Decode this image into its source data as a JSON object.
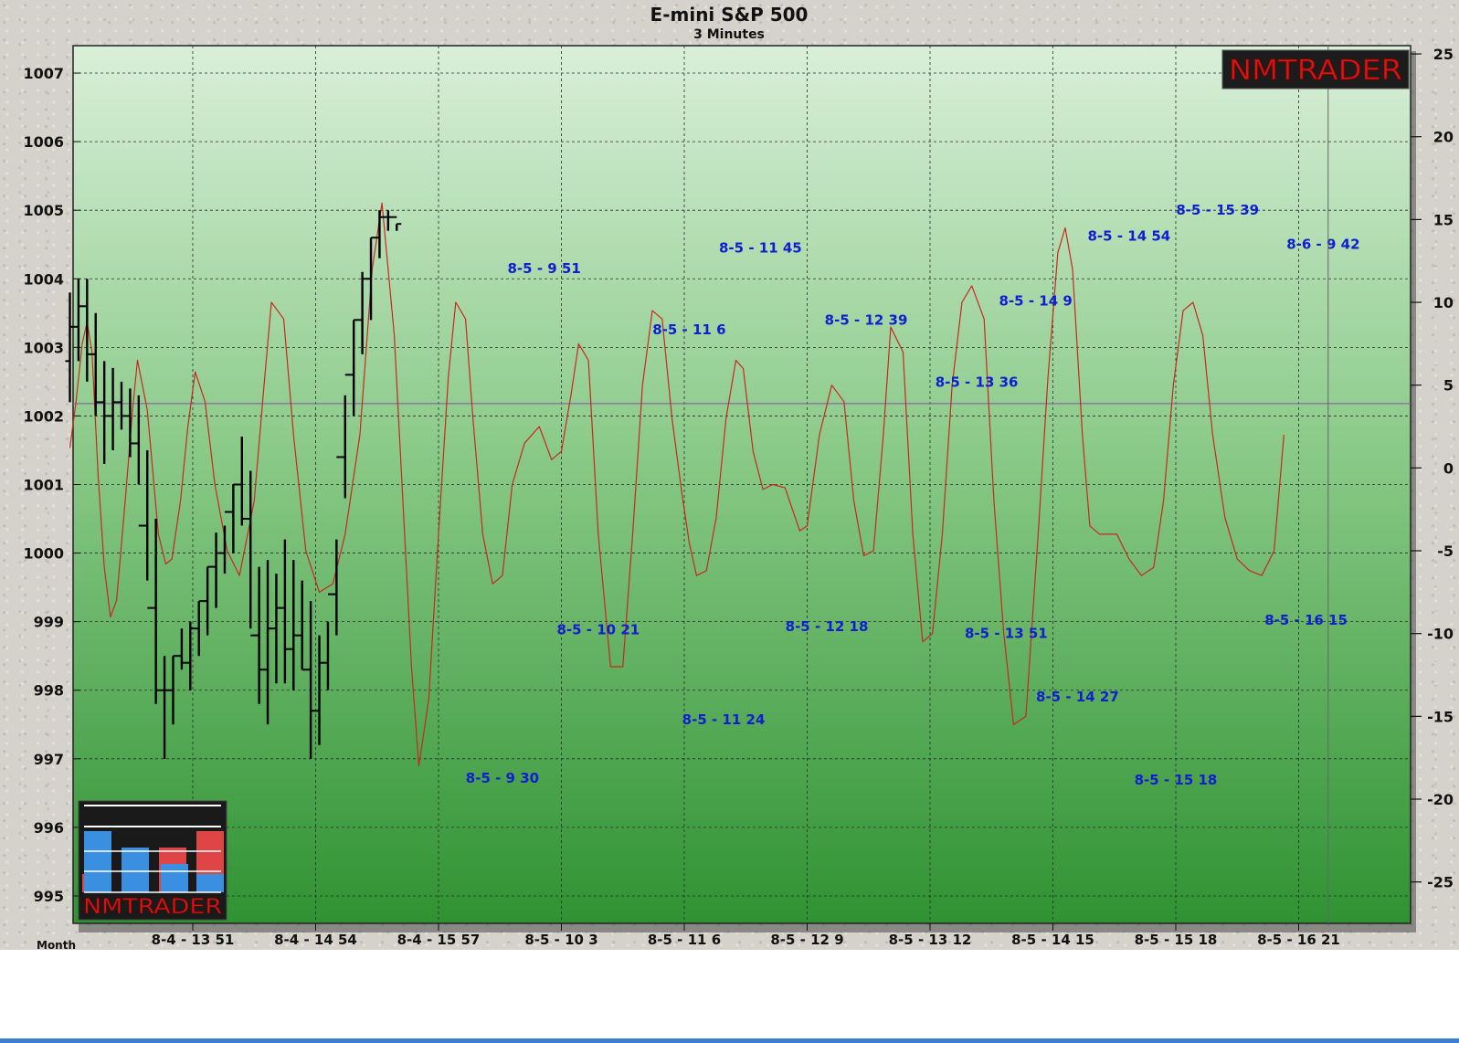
{
  "chart_data": {
    "type": "line",
    "title": "E-mini S&P 500",
    "subtitle": "3 Minutes",
    "xlabel": "Month",
    "x_ticks": [
      "8-4 - 13 51",
      "8-4 - 14 54",
      "8-4 - 15 57",
      "8-5 - 10 3",
      "8-5 - 11 6",
      "8-5 - 12 9",
      "8-5 - 13 12",
      "8-5 - 14 15",
      "8-5 - 15 18",
      "8-5 - 16 21"
    ],
    "left_axis": {
      "ticks": [
        995,
        996,
        997,
        998,
        999,
        1000,
        1001,
        1002,
        1003,
        1004,
        1005,
        1006,
        1007
      ],
      "range": [
        994.6,
        1007.4
      ]
    },
    "right_axis": {
      "ticks": [
        25,
        20,
        15,
        10,
        5,
        0,
        -5,
        -10,
        -15,
        -20,
        -25
      ],
      "range": [
        -27.5,
        25.5
      ]
    },
    "reference_line_price": 1002.18,
    "cursor_line_label_index": 9.24,
    "grid": true,
    "logo_text": "NMTRADER",
    "colors": {
      "price": "#000000",
      "oscillator": "#c8281e",
      "annotations": "#1020d0",
      "grid": "#2a2a2a",
      "reference_line": "#8a6aa0"
    },
    "series": [
      {
        "role": "price-bars",
        "x_index": [
          0.0,
          0.07,
          0.14,
          0.21,
          0.28,
          0.35,
          0.42,
          0.49,
          0.56,
          0.63,
          0.7,
          0.77,
          0.84,
          0.91,
          0.98,
          1.05,
          1.12,
          1.19,
          1.26,
          1.33,
          1.4,
          1.47,
          1.54,
          1.61,
          1.68,
          1.75,
          1.82,
          1.89,
          1.96,
          2.03,
          2.1,
          2.17,
          2.24,
          2.31,
          2.38,
          2.45,
          2.52,
          2.59,
          2.66,
          2.73,
          2.8,
          2.87,
          2.94,
          3.01,
          3.08,
          3.15,
          3.22,
          3.29,
          3.36,
          3.45,
          3.55,
          3.6,
          3.65
        ],
        "high": [
          1003.8,
          1004.0,
          1004.0,
          1003.5,
          1002.8,
          1002.7,
          1002.5,
          1002.4,
          1002.3,
          1001.5,
          1000.5,
          998.5,
          998.5,
          998.9,
          999.0,
          999.3,
          999.8,
          1000.3,
          1000.4,
          1001.0,
          1001.7,
          1001.2,
          999.8,
          999.9,
          999.7,
          1000.2,
          999.9,
          999.6,
          999.3,
          998.8,
          999.0,
          1000.2,
          1002.3,
          1003.4,
          1004.1,
          1004.6,
          1005.0,
          1005.0,
          1004.8
        ],
        "low": [
          1002.2,
          1002.8,
          1002.5,
          1002.0,
          1001.3,
          1001.5,
          1001.8,
          1001.4,
          1001.0,
          999.6,
          997.8,
          997.0,
          997.5,
          998.3,
          998.0,
          998.5,
          998.8,
          999.2,
          999.7,
          1000.0,
          1000.4,
          998.9,
          997.8,
          997.5,
          998.1,
          998.1,
          998.0,
          998.3,
          997.0,
          997.2,
          998.0,
          998.8,
          1000.8,
          1002.0,
          1002.9,
          1003.4,
          1004.3,
          1004.7,
          1004.7
        ],
        "open": [
          1002.8,
          1003.3,
          1003.6,
          1002.9,
          1002.2,
          1002.0,
          1002.2,
          1002.0,
          1001.6,
          1000.4,
          999.2,
          998.0,
          998.0,
          998.5,
          998.4,
          998.9,
          999.3,
          999.8,
          1000.0,
          1000.6,
          1001.0,
          1000.5,
          998.8,
          998.3,
          998.9,
          999.2,
          998.6,
          998.8,
          998.3,
          997.7,
          998.4,
          999.4,
          1001.4,
          1002.6,
          1003.4,
          1004.0,
          1004.6,
          1004.9,
          1004.9
        ],
        "close": [
          1003.3,
          1003.6,
          1002.9,
          1002.2,
          1002.0,
          1002.2,
          1002.0,
          1001.6,
          1000.4,
          999.2,
          998.0,
          998.0,
          998.5,
          998.4,
          998.9,
          999.3,
          999.8,
          1000.0,
          1000.6,
          1001.0,
          1000.5,
          998.8,
          998.3,
          998.9,
          999.2,
          998.6,
          998.8,
          998.3,
          997.7,
          998.4,
          999.4,
          1001.4,
          1002.6,
          1003.4,
          1004.0,
          1004.6,
          1004.9,
          1004.9,
          1004.8
        ]
      },
      {
        "role": "oscillator",
        "x_index": [
          0.0,
          0.05,
          0.1,
          0.14,
          0.18,
          0.23,
          0.28,
          0.33,
          0.38,
          0.45,
          0.51,
          0.55,
          0.63,
          0.72,
          0.78,
          0.83,
          0.9,
          0.96,
          1.02,
          1.1,
          1.18,
          1.28,
          1.38,
          1.5,
          1.58,
          1.64,
          1.74,
          1.82,
          1.92,
          2.03,
          2.14,
          2.24,
          2.36,
          2.46,
          2.54,
          2.64,
          2.71,
          2.78,
          2.84,
          2.92,
          3.0,
          3.08,
          3.14,
          3.22,
          3.28,
          3.36,
          3.44,
          3.52,
          3.6,
          3.7,
          3.82,
          3.92,
          4.0,
          4.08,
          4.14,
          4.22,
          4.3,
          4.4,
          4.5,
          4.58,
          4.66,
          4.74,
          4.82,
          4.9,
          4.98,
          5.04,
          5.1,
          5.18,
          5.26,
          5.34,
          5.42,
          5.48,
          5.56,
          5.64,
          5.72,
          5.82,
          5.88,
          5.94,
          6.0,
          6.1,
          6.2,
          6.3,
          6.38,
          6.46,
          6.54,
          6.62,
          6.68,
          6.78,
          6.86,
          6.94,
          7.02,
          7.1,
          7.18,
          7.26,
          7.34,
          7.44,
          7.52,
          7.6,
          7.68,
          7.78,
          7.88,
          7.96,
          8.04,
          8.1,
          8.16,
          8.24,
          8.3,
          8.38,
          8.44,
          8.52,
          8.62,
          8.72,
          8.82,
          8.9,
          8.98,
          9.06,
          9.14,
          9.22,
          9.3,
          9.4,
          9.5,
          9.6,
          9.7,
          9.8,
          9.88
        ],
        "values": [
          1.2,
          4.0,
          7.5,
          8.8,
          7.0,
          -0.5,
          -6.0,
          -9.0,
          -8.0,
          -2.0,
          3.5,
          6.5,
          3.5,
          -4.0,
          -5.8,
          -5.5,
          -2.0,
          2.5,
          5.8,
          4.0,
          -1.0,
          -5.0,
          -6.5,
          -2.0,
          5.0,
          10.0,
          9.0,
          2.0,
          -5.0,
          -7.5,
          -7.0,
          -4.0,
          2.0,
          12.0,
          16.0,
          8.0,
          -2.0,
          -12.0,
          -18.0,
          -14.0,
          -4.0,
          5.5,
          10.0,
          9.0,
          3.0,
          -4.0,
          -7.0,
          -6.5,
          -1.0,
          1.5,
          2.5,
          0.5,
          1.0,
          4.5,
          7.5,
          6.5,
          -4.0,
          -12.0,
          -12.0,
          -4.0,
          5.0,
          9.5,
          9.0,
          3.0,
          -1.5,
          -4.5,
          -6.5,
          -6.2,
          -3.0,
          3.0,
          6.5,
          6.0,
          1.0,
          -1.3,
          -1.0,
          -1.2,
          -2.5,
          -3.8,
          -3.5,
          2.0,
          5.0,
          4.0,
          -2.0,
          -5.3,
          -5.0,
          2.0,
          8.5,
          7.0,
          -4.0,
          -10.5,
          -10.0,
          -4.0,
          5.0,
          10.0,
          11.0,
          9.0,
          -2.0,
          -10.0,
          -15.5,
          -15.0,
          -4.0,
          5.5,
          13.0,
          14.5,
          12.0,
          2.0,
          -3.5,
          -4.0,
          -4.0,
          -4.0,
          -5.5,
          -6.5,
          -6.0,
          -2.0,
          5.0,
          9.5,
          10.0,
          8.0,
          2.0,
          -3.0,
          -5.5,
          -6.2,
          -6.5,
          -5.0,
          2.0
        ]
      }
    ],
    "annotations": [
      {
        "text": "8-5 - 9 51",
        "x_index": 3.86,
        "price": 1004.15
      },
      {
        "text": "8-5 - 9 30",
        "x_index": 3.52,
        "price": 996.72
      },
      {
        "text": "8-5 - 10 21",
        "x_index": 4.3,
        "price": 998.88
      },
      {
        "text": "8-5 - 11 6",
        "x_index": 5.04,
        "price": 1003.26
      },
      {
        "text": "8-5 - 11 24",
        "x_index": 5.32,
        "price": 997.57
      },
      {
        "text": "8-5 - 11 45",
        "x_index": 5.62,
        "price": 1004.45
      },
      {
        "text": "8-5 - 12 18",
        "x_index": 6.16,
        "price": 998.93
      },
      {
        "text": "8-5 - 12 39",
        "x_index": 6.48,
        "price": 1003.4
      },
      {
        "text": "8-5 - 13 36",
        "x_index": 7.38,
        "price": 1002.49
      },
      {
        "text": "8-5 - 13 51",
        "x_index": 7.62,
        "price": 998.83
      },
      {
        "text": "8-5 - 14 9",
        "x_index": 7.86,
        "price": 1003.68
      },
      {
        "text": "8-5 - 14 27",
        "x_index": 8.2,
        "price": 997.9
      },
      {
        "text": "8-5 - 14 54",
        "x_index": 8.62,
        "price": 1004.62
      },
      {
        "text": "8-5 - 15 18",
        "x_index": 9.0,
        "price": 996.69
      },
      {
        "text": "8-5 - 15 39",
        "x_index": 9.34,
        "price": 1005.0
      },
      {
        "text": "8-5 - 16 15",
        "x_index": 10.06,
        "price": 999.02
      },
      {
        "text": "8-6 - 9 42",
        "x_index": 10.2,
        "price": 1004.5
      }
    ]
  }
}
